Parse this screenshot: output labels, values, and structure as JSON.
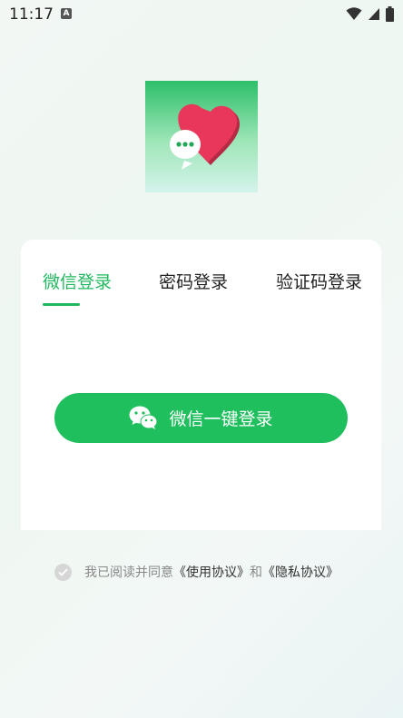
{
  "status_bar": {
    "time": "11:17",
    "badge": "A"
  },
  "tabs": [
    {
      "label": "微信登录",
      "active": true
    },
    {
      "label": "密码登录",
      "active": false
    },
    {
      "label": "验证码登录",
      "active": false
    }
  ],
  "wechat_button": {
    "label": "微信一键登录",
    "icon": "wechat-icon"
  },
  "agreement": {
    "prefix": "我已阅读并同意",
    "terms_link": "《使用协议》",
    "conjunction": "和",
    "privacy_link": "《隐私协议》"
  },
  "colors": {
    "accent": "#20b85e",
    "button": "#1fbf5e",
    "heart": "#e8375a"
  }
}
